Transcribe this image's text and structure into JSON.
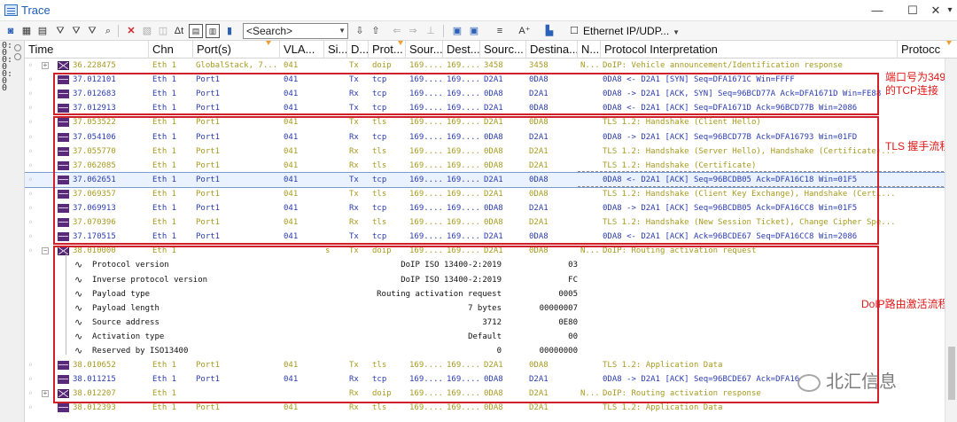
{
  "window": {
    "title": "Trace",
    "controls": [
      "—",
      "☐",
      "✕",
      "▾"
    ]
  },
  "toolbar": {
    "search_placeholder": "<Search>",
    "filter_label": "Ethernet IP/UDP..."
  },
  "gutter_text": "0:00:00:00",
  "columns": [
    {
      "key": "time",
      "label": "Time"
    },
    {
      "key": "chn",
      "label": "Chn"
    },
    {
      "key": "port",
      "label": "Port(s)"
    },
    {
      "key": "vlan",
      "label": "VLA..."
    },
    {
      "key": "si",
      "label": "Si..."
    },
    {
      "key": "d",
      "label": "D..."
    },
    {
      "key": "prot",
      "label": "Prot..."
    },
    {
      "key": "sour",
      "label": "Sour..."
    },
    {
      "key": "dest",
      "label": "Dest..."
    },
    {
      "key": "sourc",
      "label": "Sourc..."
    },
    {
      "key": "destina",
      "label": "Destina..."
    },
    {
      "key": "n",
      "label": "N..."
    },
    {
      "key": "interp",
      "label": "Protocol Interpretation"
    },
    {
      "key": "protoc",
      "label": "Protocc"
    }
  ],
  "colors": {
    "tls": "#a89a20",
    "tcp": "#2a3cb0",
    "doip": "#a89a20",
    "annotation": "#e01818"
  },
  "rows": [
    {
      "kind": "env",
      "exp": "+",
      "time": "36.228475",
      "chn": "Eth 1",
      "port": "GlobalStack, 7...",
      "vlan": "041",
      "si": "",
      "d": "Tx",
      "prot": "doip",
      "sour": "169....",
      "dest": "169....",
      "sourc": "3458",
      "destina": "3458",
      "n": "N...",
      "interp": "DoIP: Vehicle announcement/Identification response",
      "cls": "tls"
    },
    {
      "kind": "bar",
      "time": "37.012101",
      "chn": "Eth 1",
      "port": "Port1",
      "vlan": "041",
      "si": "",
      "d": "Tx",
      "prot": "tcp",
      "sour": "169....",
      "dest": "169....",
      "sourc": "D2A1",
      "destina": "0DA8",
      "n": "",
      "interp": "0DA8 <- D2A1 [SYN] Seq=DFA1671C Win=FFFF",
      "cls": "tcp"
    },
    {
      "kind": "bar",
      "time": "37.012683",
      "chn": "Eth 1",
      "port": "Port1",
      "vlan": "041",
      "si": "",
      "d": "Rx",
      "prot": "tcp",
      "sour": "169....",
      "dest": "169....",
      "sourc": "0DA8",
      "destina": "D2A1",
      "n": "",
      "interp": "0DA8 -> D2A1 [ACK, SYN] Seq=96BCD77A Ack=DFA1671D Win=FE88",
      "cls": "tcp"
    },
    {
      "kind": "bar",
      "time": "37.012913",
      "chn": "Eth 1",
      "port": "Port1",
      "vlan": "041",
      "si": "",
      "d": "Tx",
      "prot": "tcp",
      "sour": "169....",
      "dest": "169....",
      "sourc": "D2A1",
      "destina": "0DA8",
      "n": "",
      "interp": "0DA8 <- D2A1 [ACK] Seq=DFA1671D Ack=96BCD77B Win=2086",
      "cls": "tcp"
    },
    {
      "kind": "bar",
      "time": "37.053522",
      "chn": "Eth 1",
      "port": "Port1",
      "vlan": "041",
      "si": "",
      "d": "Tx",
      "prot": "tls",
      "sour": "169....",
      "dest": "169....",
      "sourc": "D2A1",
      "destina": "0DA8",
      "n": "",
      "interp": "TLS 1.2: Handshake (Client Hello)",
      "cls": "tls"
    },
    {
      "kind": "bar",
      "time": "37.054106",
      "chn": "Eth 1",
      "port": "Port1",
      "vlan": "041",
      "si": "",
      "d": "Rx",
      "prot": "tcp",
      "sour": "169....",
      "dest": "169....",
      "sourc": "0DA8",
      "destina": "D2A1",
      "n": "",
      "interp": "0DA8 -> D2A1 [ACK] Seq=96BCD77B Ack=DFA16793 Win=01FD",
      "cls": "tcp"
    },
    {
      "kind": "bar",
      "time": "37.055770",
      "chn": "Eth 1",
      "port": "Port1",
      "vlan": "041",
      "si": "",
      "d": "Rx",
      "prot": "tls",
      "sour": "169....",
      "dest": "169....",
      "sourc": "0DA8",
      "destina": "D2A1",
      "n": "",
      "interp": "TLS 1.2: Handshake (Server Hello), Handshake (Certificate)...",
      "cls": "tls"
    },
    {
      "kind": "bar",
      "time": "37.062085",
      "chn": "Eth 1",
      "port": "Port1",
      "vlan": "041",
      "si": "",
      "d": "Rx",
      "prot": "tls",
      "sour": "169....",
      "dest": "169....",
      "sourc": "0DA8",
      "destina": "D2A1",
      "n": "",
      "interp": "TLS 1.2: Handshake (Certificate)",
      "cls": "tls"
    },
    {
      "kind": "bar",
      "sel": true,
      "time": "37.062651",
      "chn": "Eth 1",
      "port": "Port1",
      "vlan": "041",
      "si": "",
      "d": "Tx",
      "prot": "tcp",
      "sour": "169....",
      "dest": "169....",
      "sourc": "D2A1",
      "destina": "0DA8",
      "n": "",
      "interp": "0DA8 <- D2A1 [ACK] Seq=96BCDB05 Ack=DFA16C18 Win=01F5",
      "cls": "tcp"
    },
    {
      "kind": "bar",
      "time": "37.069357",
      "chn": "Eth 1",
      "port": "Port1",
      "vlan": "041",
      "si": "",
      "d": "Tx",
      "prot": "tls",
      "sour": "169....",
      "dest": "169....",
      "sourc": "D2A1",
      "destina": "0DA8",
      "n": "",
      "interp": "TLS 1.2: Handshake (Client Key Exchange), Handshake (Certi...",
      "cls": "tls"
    },
    {
      "kind": "bar",
      "time": "37.069913",
      "chn": "Eth 1",
      "port": "Port1",
      "vlan": "041",
      "si": "",
      "d": "Rx",
      "prot": "tcp",
      "sour": "169....",
      "dest": "169....",
      "sourc": "0DA8",
      "destina": "D2A1",
      "n": "",
      "interp": "0DA8 -> D2A1 [ACK] Seq=96BCDB05 Ack=DFA16CC8 Win=01F5",
      "cls": "tcp"
    },
    {
      "kind": "bar",
      "time": "37.070396",
      "chn": "Eth 1",
      "port": "Port1",
      "vlan": "041",
      "si": "",
      "d": "Rx",
      "prot": "tls",
      "sour": "169....",
      "dest": "169....",
      "sourc": "0DA8",
      "destina": "D2A1",
      "n": "",
      "interp": "TLS 1.2: Handshake (New Session Ticket), Change Cipher Spe...",
      "cls": "tls"
    },
    {
      "kind": "bar",
      "time": "37.170515",
      "chn": "Eth 1",
      "port": "Port1",
      "vlan": "041",
      "si": "",
      "d": "Tx",
      "prot": "tcp",
      "sour": "169....",
      "dest": "169....",
      "sourc": "D2A1",
      "destina": "0DA8",
      "n": "",
      "interp": "0DA8 <- D2A1 [ACK] Ack=96BCDE67 Seq=DFA16CC8 Win=2086",
      "cls": "tcp"
    },
    {
      "kind": "env",
      "exp": "−",
      "time": "38.010000",
      "chn": "Eth 1",
      "port": "",
      "vlan": "",
      "si": "s",
      "d": "Tx",
      "prot": "doip",
      "sour": "169....",
      "dest": "169....",
      "sourc": "D2A1",
      "destina": "0DA8",
      "n": "N...",
      "interp": "DoIP: Routing activation request",
      "cls": "tls"
    },
    {
      "kind": "tree",
      "name": "Protocol version",
      "value": "DoIP ISO 13400-2:2019",
      "raw": "03"
    },
    {
      "kind": "tree",
      "name": "Inverse protocol version",
      "value": "DoIP ISO 13400-2:2019",
      "raw": "FC"
    },
    {
      "kind": "tree",
      "name": "Payload type",
      "value": "Routing activation request",
      "raw": "0005"
    },
    {
      "kind": "tree",
      "name": "Payload length",
      "value": "7 bytes",
      "raw": "00000007"
    },
    {
      "kind": "tree",
      "name": "Source address",
      "value": "3712",
      "raw": "0E80"
    },
    {
      "kind": "tree",
      "name": "Activation type",
      "value": "Default",
      "raw": "00"
    },
    {
      "kind": "tree",
      "name": "Reserved by ISO13400",
      "value": "0",
      "raw": "00000000"
    },
    {
      "kind": "bar",
      "time": "38.010652",
      "chn": "Eth 1",
      "port": "Port1",
      "vlan": "041",
      "si": "",
      "d": "Tx",
      "prot": "tls",
      "sour": "169....",
      "dest": "169....",
      "sourc": "D2A1",
      "destina": "0DA8",
      "n": "",
      "interp": "TLS 1.2: Application Data",
      "cls": "tls"
    },
    {
      "kind": "bar",
      "time": "38.011215",
      "chn": "Eth 1",
      "port": "Port1",
      "vlan": "041",
      "si": "",
      "d": "Rx",
      "prot": "tcp",
      "sour": "169....",
      "dest": "169....",
      "sourc": "0DA8",
      "destina": "D2A1",
      "n": "",
      "interp": "0DA8 -> D2A1 [ACK] Seq=96BCDE67 Ack=DFA16",
      "cls": "tcp"
    },
    {
      "kind": "env",
      "exp": "+",
      "time": "38.012207",
      "chn": "Eth 1",
      "port": "",
      "vlan": "",
      "si": "",
      "d": "Rx",
      "prot": "doip",
      "sour": "169....",
      "dest": "169....",
      "sourc": "0DA8",
      "destina": "D2A1",
      "n": "N...",
      "interp": "DoIP: Routing activation response",
      "cls": "tls"
    },
    {
      "kind": "bar",
      "time": "38.012393",
      "chn": "Eth 1",
      "port": "Port1",
      "vlan": "041",
      "si": "",
      "d": "Rx",
      "prot": "tls",
      "sour": "169....",
      "dest": "169....",
      "sourc": "0DA8",
      "destina": "D2A1",
      "n": "",
      "interp": "TLS 1.2: Application Data",
      "cls": "tls"
    }
  ],
  "annotations": {
    "tcp": "端口号为3496的TCP连接",
    "tls": "TLS 握手流程",
    "doip": "DoIP路由激活流程"
  },
  "watermark": "北汇信息"
}
